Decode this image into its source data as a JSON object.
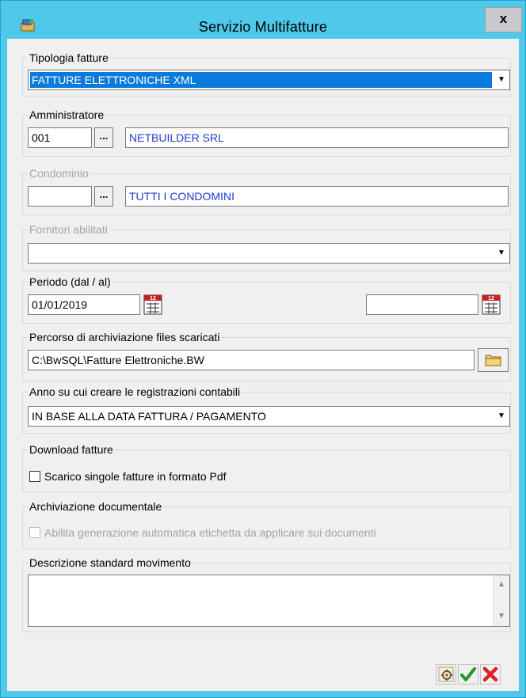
{
  "window": {
    "title": "Servizio Multifatture",
    "close_label": "x"
  },
  "tipologia": {
    "legend": "Tipologia fatture",
    "value": "FATTURE ELETTRONICHE XML"
  },
  "amministratore": {
    "legend": "Amministratore",
    "code": "001",
    "name": "NETBUILDER SRL",
    "lookup_label": "..."
  },
  "condominio": {
    "legend": "Condominio",
    "code": "",
    "name": "TUTTI I CONDOMINI",
    "lookup_label": "..."
  },
  "fornitori": {
    "legend": "Fornitori abilitati",
    "value": ""
  },
  "periodo": {
    "legend": "Periodo (dal / al)",
    "from": "01/01/2019",
    "to": ""
  },
  "percorso": {
    "legend": "Percorso di archiviazione files scaricati",
    "value": "C:\\BwSQL\\Fatture Elettroniche.BW"
  },
  "anno": {
    "legend": "Anno su cui creare le registrazioni contabili",
    "value": "IN BASE ALLA DATA FATTURA / PAGAMENTO"
  },
  "download": {
    "legend": "Download fatture",
    "checkbox_label": "Scarico singole fatture in formato Pdf",
    "checked": false
  },
  "archiviazione": {
    "legend": "Archiviazione documentale",
    "checkbox_label": "Abilita generazione automatica etichetta da applicare sui documenti",
    "checked": false
  },
  "descrizione": {
    "legend": "Descrizione standard movimento",
    "value": ""
  },
  "icons": {
    "calendar": "calendar-icon",
    "folder": "folder-icon",
    "settings": "gear-icon",
    "confirm": "check-icon",
    "cancel": "cross-icon"
  },
  "colors": {
    "titlebar": "#4fc8ea",
    "selection": "#0a7bdb",
    "link_blue": "#1f3bd3",
    "confirm_green": "#1f9a2b",
    "cancel_red": "#e02020"
  }
}
